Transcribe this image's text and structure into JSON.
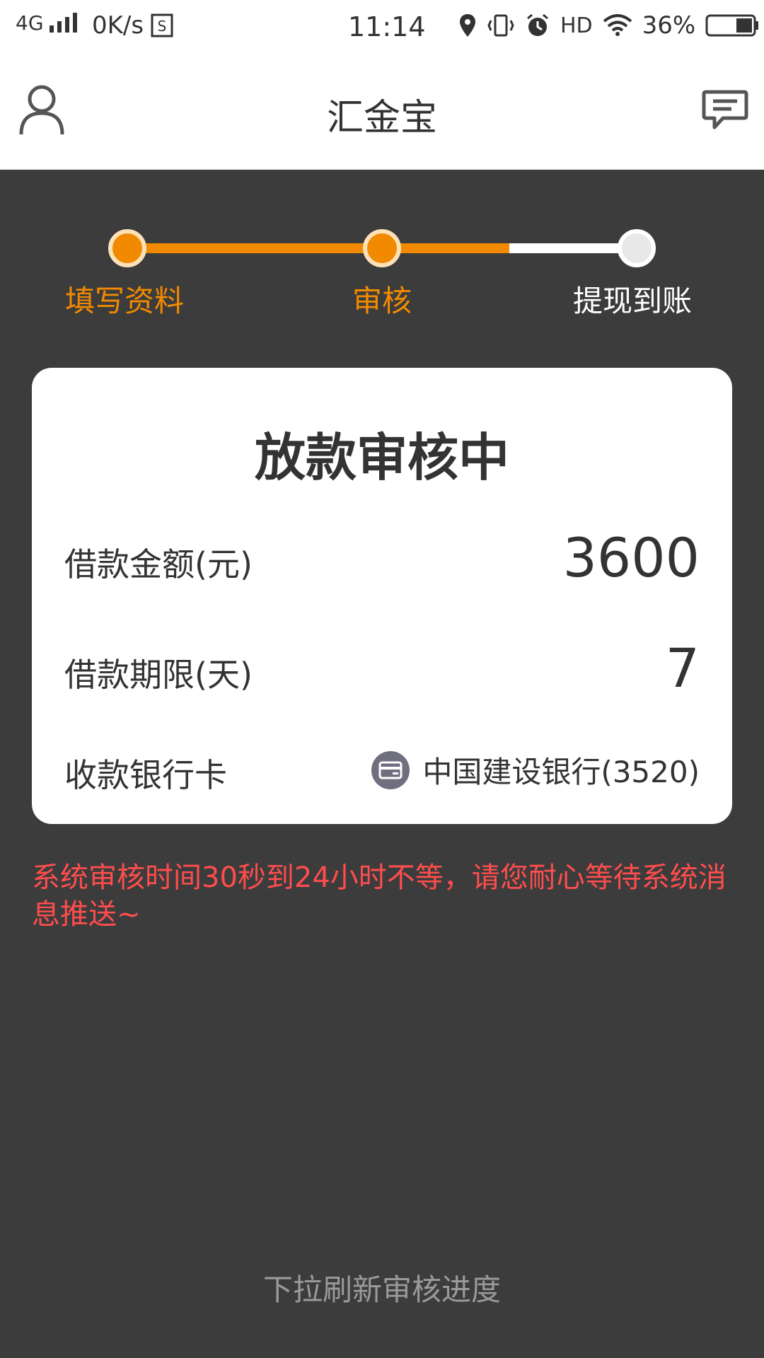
{
  "status_bar": {
    "network": "4G",
    "speed": "0K/s",
    "time": "11:14",
    "hd": "HD",
    "battery": "36%"
  },
  "nav": {
    "title": "汇金宝",
    "left_icon": "user-icon",
    "right_icon": "message-icon"
  },
  "progress": {
    "steps": [
      {
        "label": "填写资料",
        "state": "done"
      },
      {
        "label": "审核",
        "state": "done"
      },
      {
        "label": "提现到账",
        "state": "pending"
      }
    ],
    "fraction": 0.75,
    "colors": {
      "active": "#f28a00",
      "inactive": "#ffffff"
    }
  },
  "card": {
    "title": "放款审核中",
    "amount_label": "借款金额(元)",
    "amount_value": "3600",
    "term_label": "借款期限(天)",
    "term_value": "7",
    "bank_label": "收款银行卡",
    "bank_icon": "bank-card-icon",
    "bank_value": "中国建设银行(3520)"
  },
  "notice": "系统审核时间30秒到24小时不等，请您耐心等待系统消息推送~",
  "footer_hint": "下拉刷新审核进度"
}
